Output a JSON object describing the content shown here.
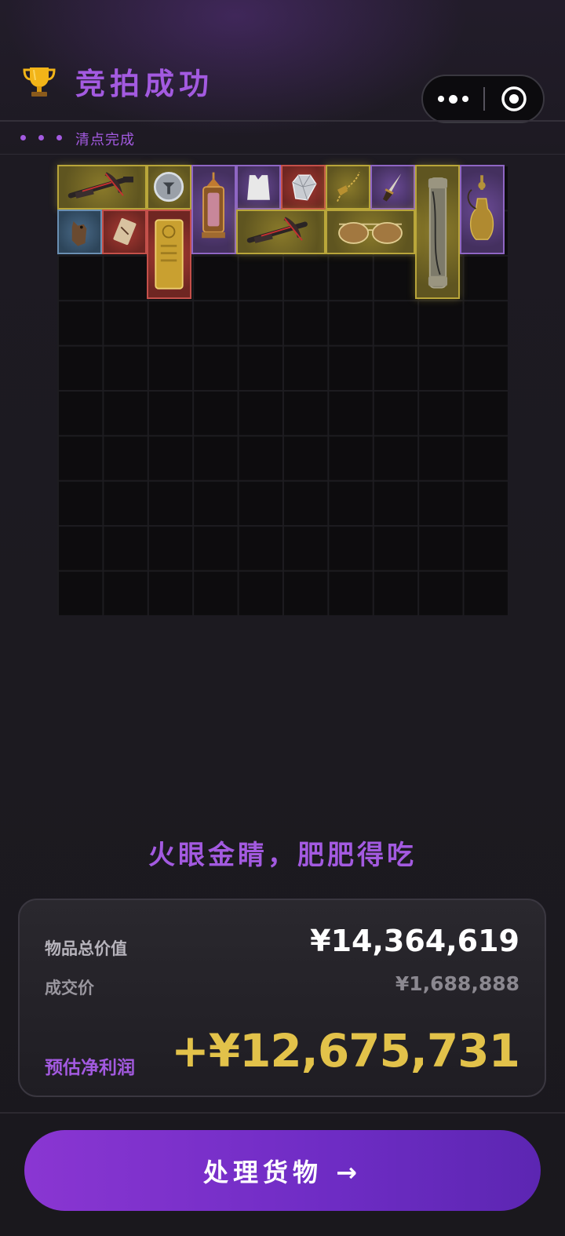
{
  "header": {
    "title": "竞拍成功",
    "trophy_icon": "trophy-icon",
    "capsule": {
      "more_icon": "more-dots-icon",
      "close_icon": "target-circle-icon"
    }
  },
  "status": {
    "text": "清点完成"
  },
  "inventory": {
    "columns": 10,
    "rows": 10,
    "items": [
      {
        "name": "crossbow",
        "rarity": "gold"
      },
      {
        "name": "silver-coin",
        "rarity": "gold"
      },
      {
        "name": "lantern",
        "rarity": "purple"
      },
      {
        "name": "white-vest",
        "rarity": "purple"
      },
      {
        "name": "diamond",
        "rarity": "red"
      },
      {
        "name": "gold-pendant",
        "rarity": "gold"
      },
      {
        "name": "dagger",
        "rarity": "purple"
      },
      {
        "name": "scroll-tube",
        "rarity": "gold"
      },
      {
        "name": "hookah-vase",
        "rarity": "purple"
      },
      {
        "name": "owl-figurine",
        "rarity": "blue"
      },
      {
        "name": "card-artifact",
        "rarity": "red"
      },
      {
        "name": "gold-bar",
        "rarity": "red"
      },
      {
        "name": "crossbow-2",
        "rarity": "gold"
      },
      {
        "name": "sunglasses",
        "rarity": "gold"
      }
    ]
  },
  "slogan": "火眼金睛，肥肥得吃",
  "summary": {
    "total_label": "物品总价值",
    "total_value": "¥14,364,619",
    "price_label": "成交价",
    "price_value": "¥1,688,888",
    "profit_label": "预估净利润",
    "profit_value": "+¥12,675,731"
  },
  "action": {
    "label": "处理货物 →"
  },
  "colors": {
    "accent": "#a35ae0",
    "profit": "#e2c24a",
    "gold_rarity": "#b8a53a",
    "purple_rarity": "#8f66c4",
    "red_rarity": "#c4504a",
    "blue_rarity": "#6a8fb2"
  }
}
